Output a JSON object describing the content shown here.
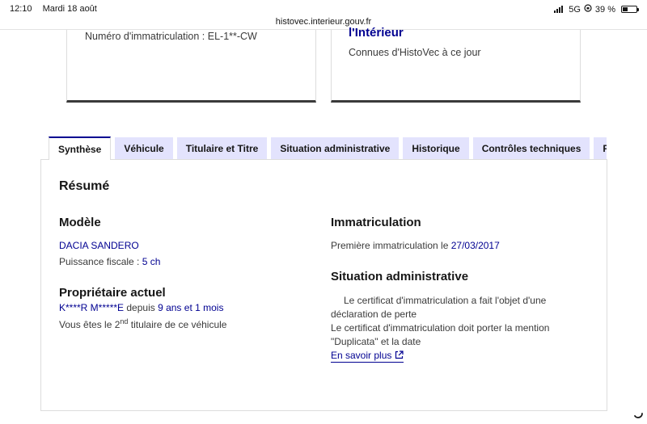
{
  "status": {
    "time": "12:10",
    "date": "Mardi 18 août",
    "url": "histovec.interieur.gouv.fr",
    "network": "5G",
    "battery": "39 %",
    "battery_fraction": 0.39
  },
  "cards": {
    "plate_text": "Numéro d'immatriculation : EL-1**-CW",
    "ministry_title": "l'Intérieur",
    "known_text": "Connues d'HistoVec à ce jour"
  },
  "tabs": [
    {
      "label": "Synthèse",
      "active": true
    },
    {
      "label": "Véhicule"
    },
    {
      "label": "Titulaire et Titre"
    },
    {
      "label": "Situation administrative"
    },
    {
      "label": "Historique"
    },
    {
      "label": "Contrôles techniques"
    },
    {
      "label": "Rapport"
    }
  ],
  "summary": {
    "title": "Résumé",
    "model": {
      "heading": "Modèle",
      "name": "DACIA SANDERO",
      "power_label": "Puissance fiscale : ",
      "power_value": "5 ch"
    },
    "owner": {
      "heading": "Propriétaire actuel",
      "name": "K****R M*****E",
      "since_label": " depuis ",
      "since_value": "9 ans et 1 mois",
      "rank_prefix": "Vous êtes le 2",
      "rank_sup": "nd",
      "rank_suffix": " titulaire de ce véhicule"
    },
    "registration": {
      "heading": "Immatriculation",
      "first_label": "Première immatriculation le ",
      "first_date": "27/03/2017"
    },
    "admin": {
      "heading": "Situation administrative",
      "line1": "Le certificat d'immatriculation a fait l'objet d'une",
      "line2": "déclaration de perte",
      "line3": "Le certificat d'immatriculation doit porter la mention",
      "line4": "\"Duplicata\" et la date",
      "link": "En savoir plus"
    }
  }
}
